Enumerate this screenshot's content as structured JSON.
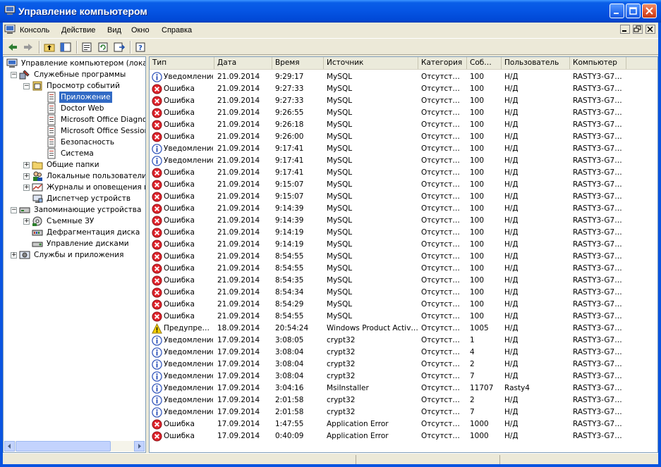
{
  "window": {
    "title": "Управление компьютером"
  },
  "menu": [
    "Консоль",
    "Действие",
    "Вид",
    "Окно",
    "Справка"
  ],
  "toolbar_icons": [
    "back-icon",
    "forward-icon",
    "up-folder-icon",
    "show-tree-icon",
    "properties-icon",
    "refresh-icon",
    "export-icon",
    "help-icon"
  ],
  "tree": [
    {
      "label": "Управление компьютером (локаль",
      "level": 0,
      "icon": "computer-icon",
      "exp": ""
    },
    {
      "label": "Служебные программы",
      "level": 1,
      "icon": "tools-icon",
      "exp": "-"
    },
    {
      "label": "Просмотр событий",
      "level": 2,
      "icon": "event-viewer-icon",
      "exp": "-"
    },
    {
      "label": "Приложение",
      "level": 3,
      "icon": "log-icon",
      "exp": "",
      "selected": true
    },
    {
      "label": "Doctor Web",
      "level": 3,
      "icon": "log-icon",
      "exp": ""
    },
    {
      "label": "Microsoft Office Diagnost",
      "level": 3,
      "icon": "log-icon",
      "exp": ""
    },
    {
      "label": "Microsoft Office Sessions",
      "level": 3,
      "icon": "log-icon",
      "exp": ""
    },
    {
      "label": "Безопасность",
      "level": 3,
      "icon": "log-icon",
      "exp": ""
    },
    {
      "label": "Система",
      "level": 3,
      "icon": "log-icon",
      "exp": ""
    },
    {
      "label": "Общие папки",
      "level": 2,
      "icon": "folder-icon",
      "exp": "+"
    },
    {
      "label": "Локальные пользователи и",
      "level": 2,
      "icon": "users-icon",
      "exp": "+"
    },
    {
      "label": "Журналы и оповещения пр",
      "level": 2,
      "icon": "alerts-icon",
      "exp": "+"
    },
    {
      "label": "Диспетчер устройств",
      "level": 2,
      "icon": "device-manager-icon",
      "exp": ""
    },
    {
      "label": "Запоминающие устройства",
      "level": 1,
      "icon": "storage-icon",
      "exp": "-"
    },
    {
      "label": "Съемные ЗУ",
      "level": 2,
      "icon": "removable-storage-icon",
      "exp": "+"
    },
    {
      "label": "Дефрагментация диска",
      "level": 2,
      "icon": "defrag-icon",
      "exp": ""
    },
    {
      "label": "Управление дисками",
      "level": 2,
      "icon": "disk-management-icon",
      "exp": ""
    },
    {
      "label": "Службы и приложения",
      "level": 1,
      "icon": "services-icon",
      "exp": "+"
    }
  ],
  "columns": [
    "Тип",
    "Дата",
    "Время",
    "Источник",
    "Категория",
    "Соб…",
    "Пользователь",
    "Компьютер"
  ],
  "colors": {
    "error": "#e0242c",
    "info": "#2a4fb8",
    "warning": "#f4d000",
    "selection": "#316ac5"
  },
  "rows": [
    {
      "kind": "info",
      "type": "Уведомление",
      "date": "21.09.2014",
      "time": "9:29:17",
      "source": "MySQL",
      "category": "Отсутст…",
      "event": "100",
      "user": "Н/Д",
      "computer": "RASTY3-G7…"
    },
    {
      "kind": "error",
      "type": "Ошибка",
      "date": "21.09.2014",
      "time": "9:27:33",
      "source": "MySQL",
      "category": "Отсутст…",
      "event": "100",
      "user": "Н/Д",
      "computer": "RASTY3-G7…"
    },
    {
      "kind": "error",
      "type": "Ошибка",
      "date": "21.09.2014",
      "time": "9:27:33",
      "source": "MySQL",
      "category": "Отсутст…",
      "event": "100",
      "user": "Н/Д",
      "computer": "RASTY3-G7…"
    },
    {
      "kind": "error",
      "type": "Ошибка",
      "date": "21.09.2014",
      "time": "9:26:55",
      "source": "MySQL",
      "category": "Отсутст…",
      "event": "100",
      "user": "Н/Д",
      "computer": "RASTY3-G7…"
    },
    {
      "kind": "error",
      "type": "Ошибка",
      "date": "21.09.2014",
      "time": "9:26:18",
      "source": "MySQL",
      "category": "Отсутст…",
      "event": "100",
      "user": "Н/Д",
      "computer": "RASTY3-G7…"
    },
    {
      "kind": "error",
      "type": "Ошибка",
      "date": "21.09.2014",
      "time": "9:26:00",
      "source": "MySQL",
      "category": "Отсутст…",
      "event": "100",
      "user": "Н/Д",
      "computer": "RASTY3-G7…"
    },
    {
      "kind": "info",
      "type": "Уведомление",
      "date": "21.09.2014",
      "time": "9:17:41",
      "source": "MySQL",
      "category": "Отсутст…",
      "event": "100",
      "user": "Н/Д",
      "computer": "RASTY3-G7…"
    },
    {
      "kind": "info",
      "type": "Уведомление",
      "date": "21.09.2014",
      "time": "9:17:41",
      "source": "MySQL",
      "category": "Отсутст…",
      "event": "100",
      "user": "Н/Д",
      "computer": "RASTY3-G7…"
    },
    {
      "kind": "error",
      "type": "Ошибка",
      "date": "21.09.2014",
      "time": "9:17:41",
      "source": "MySQL",
      "category": "Отсутст…",
      "event": "100",
      "user": "Н/Д",
      "computer": "RASTY3-G7…"
    },
    {
      "kind": "error",
      "type": "Ошибка",
      "date": "21.09.2014",
      "time": "9:15:07",
      "source": "MySQL",
      "category": "Отсутст…",
      "event": "100",
      "user": "Н/Д",
      "computer": "RASTY3-G7…"
    },
    {
      "kind": "error",
      "type": "Ошибка",
      "date": "21.09.2014",
      "time": "9:15:07",
      "source": "MySQL",
      "category": "Отсутст…",
      "event": "100",
      "user": "Н/Д",
      "computer": "RASTY3-G7…"
    },
    {
      "kind": "error",
      "type": "Ошибка",
      "date": "21.09.2014",
      "time": "9:14:39",
      "source": "MySQL",
      "category": "Отсутст…",
      "event": "100",
      "user": "Н/Д",
      "computer": "RASTY3-G7…"
    },
    {
      "kind": "error",
      "type": "Ошибка",
      "date": "21.09.2014",
      "time": "9:14:39",
      "source": "MySQL",
      "category": "Отсутст…",
      "event": "100",
      "user": "Н/Д",
      "computer": "RASTY3-G7…"
    },
    {
      "kind": "error",
      "type": "Ошибка",
      "date": "21.09.2014",
      "time": "9:14:19",
      "source": "MySQL",
      "category": "Отсутст…",
      "event": "100",
      "user": "Н/Д",
      "computer": "RASTY3-G7…"
    },
    {
      "kind": "error",
      "type": "Ошибка",
      "date": "21.09.2014",
      "time": "9:14:19",
      "source": "MySQL",
      "category": "Отсутст…",
      "event": "100",
      "user": "Н/Д",
      "computer": "RASTY3-G7…"
    },
    {
      "kind": "error",
      "type": "Ошибка",
      "date": "21.09.2014",
      "time": "8:54:55",
      "source": "MySQL",
      "category": "Отсутст…",
      "event": "100",
      "user": "Н/Д",
      "computer": "RASTY3-G7…"
    },
    {
      "kind": "error",
      "type": "Ошибка",
      "date": "21.09.2014",
      "time": "8:54:55",
      "source": "MySQL",
      "category": "Отсутст…",
      "event": "100",
      "user": "Н/Д",
      "computer": "RASTY3-G7…"
    },
    {
      "kind": "error",
      "type": "Ошибка",
      "date": "21.09.2014",
      "time": "8:54:35",
      "source": "MySQL",
      "category": "Отсутст…",
      "event": "100",
      "user": "Н/Д",
      "computer": "RASTY3-G7…"
    },
    {
      "kind": "error",
      "type": "Ошибка",
      "date": "21.09.2014",
      "time": "8:54:34",
      "source": "MySQL",
      "category": "Отсутст…",
      "event": "100",
      "user": "Н/Д",
      "computer": "RASTY3-G7…"
    },
    {
      "kind": "error",
      "type": "Ошибка",
      "date": "21.09.2014",
      "time": "8:54:29",
      "source": "MySQL",
      "category": "Отсутст…",
      "event": "100",
      "user": "Н/Д",
      "computer": "RASTY3-G7…"
    },
    {
      "kind": "error",
      "type": "Ошибка",
      "date": "21.09.2014",
      "time": "8:54:55",
      "source": "MySQL",
      "category": "Отсутст…",
      "event": "100",
      "user": "Н/Д",
      "computer": "RASTY3-G7…"
    },
    {
      "kind": "warning",
      "type": "Предупре…",
      "date": "18.09.2014",
      "time": "20:54:24",
      "source": "Windows Product Activ…",
      "category": "Отсутст…",
      "event": "1005",
      "user": "Н/Д",
      "computer": "RASTY3-G7…"
    },
    {
      "kind": "info",
      "type": "Уведомление",
      "date": "17.09.2014",
      "time": "3:08:05",
      "source": "crypt32",
      "category": "Отсутст…",
      "event": "1",
      "user": "Н/Д",
      "computer": "RASTY3-G7…"
    },
    {
      "kind": "info",
      "type": "Уведомление",
      "date": "17.09.2014",
      "time": "3:08:04",
      "source": "crypt32",
      "category": "Отсутст…",
      "event": "4",
      "user": "Н/Д",
      "computer": "RASTY3-G7…"
    },
    {
      "kind": "info",
      "type": "Уведомление",
      "date": "17.09.2014",
      "time": "3:08:04",
      "source": "crypt32",
      "category": "Отсутст…",
      "event": "2",
      "user": "Н/Д",
      "computer": "RASTY3-G7…"
    },
    {
      "kind": "info",
      "type": "Уведомление",
      "date": "17.09.2014",
      "time": "3:08:04",
      "source": "crypt32",
      "category": "Отсутст…",
      "event": "7",
      "user": "Н/Д",
      "computer": "RASTY3-G7…"
    },
    {
      "kind": "info",
      "type": "Уведомление",
      "date": "17.09.2014",
      "time": "3:04:16",
      "source": "MsiInstaller",
      "category": "Отсутст…",
      "event": "11707",
      "user": "Rasty4",
      "computer": "RASTY3-G7…"
    },
    {
      "kind": "info",
      "type": "Уведомление",
      "date": "17.09.2014",
      "time": "2:01:58",
      "source": "crypt32",
      "category": "Отсутст…",
      "event": "2",
      "user": "Н/Д",
      "computer": "RASTY3-G7…"
    },
    {
      "kind": "info",
      "type": "Уведомление",
      "date": "17.09.2014",
      "time": "2:01:58",
      "source": "crypt32",
      "category": "Отсутст…",
      "event": "7",
      "user": "Н/Д",
      "computer": "RASTY3-G7…"
    },
    {
      "kind": "error",
      "type": "Ошибка",
      "date": "17.09.2014",
      "time": "1:47:55",
      "source": "Application Error",
      "category": "Отсутст…",
      "event": "1000",
      "user": "Н/Д",
      "computer": "RASTY3-G7…"
    },
    {
      "kind": "error",
      "type": "Ошибка",
      "date": "17.09.2014",
      "time": "0:40:09",
      "source": "Application Error",
      "category": "Отсутст…",
      "event": "1000",
      "user": "Н/Д",
      "computer": "RASTY3-G7…"
    }
  ]
}
